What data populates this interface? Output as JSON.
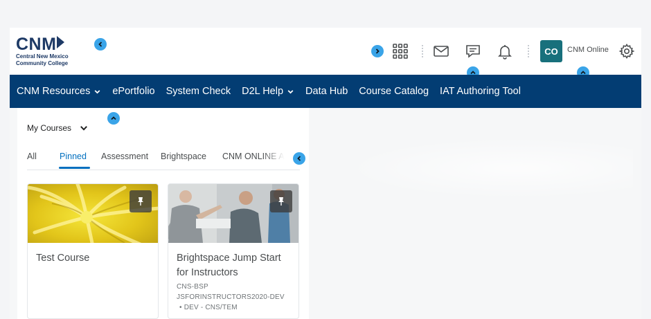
{
  "header": {
    "logo": {
      "wordmark": "CNM",
      "line1": "Central New Mexico",
      "line2": "Community College"
    },
    "icons": [
      "apps-grid-icon",
      "mail-icon",
      "chat-icon",
      "bell-icon",
      "gear-icon"
    ],
    "user": {
      "initials": "CO",
      "name": "CNM Online",
      "avatar_color": "#18707c"
    }
  },
  "nav": {
    "background": "#033d73",
    "items": [
      {
        "label": "CNM Resources",
        "has_dropdown": true
      },
      {
        "label": "ePortfolio",
        "has_dropdown": false
      },
      {
        "label": "System Check",
        "has_dropdown": false
      },
      {
        "label": "D2L Help",
        "has_dropdown": true
      },
      {
        "label": "Data Hub",
        "has_dropdown": false
      },
      {
        "label": "Course Catalog",
        "has_dropdown": false
      },
      {
        "label": "IAT Authoring Tool",
        "has_dropdown": false
      }
    ]
  },
  "my_courses": {
    "title": "My Courses",
    "tabs": [
      {
        "label": "All",
        "active": false
      },
      {
        "label": "Pinned",
        "active": true
      },
      {
        "label": "Assessment",
        "active": false
      },
      {
        "label": "Brightspace",
        "active": false
      },
      {
        "label": "CNM ONLINE ADMIN",
        "active": false
      }
    ],
    "accent_color": "#006fbf",
    "cards": [
      {
        "title": "Test Course",
        "meta": [],
        "pinned": true,
        "image": "yellow-flower"
      },
      {
        "title": "Brightspace Jump Start for Instructors",
        "meta": [
          "CNS-BSP",
          "JSFORINSTRUCTORS2020-DEV",
          "DEV - CNS/TEM"
        ],
        "pinned": true,
        "image": "classroom-photo"
      }
    ]
  },
  "overlay_markers_color": "#3aa4e8"
}
